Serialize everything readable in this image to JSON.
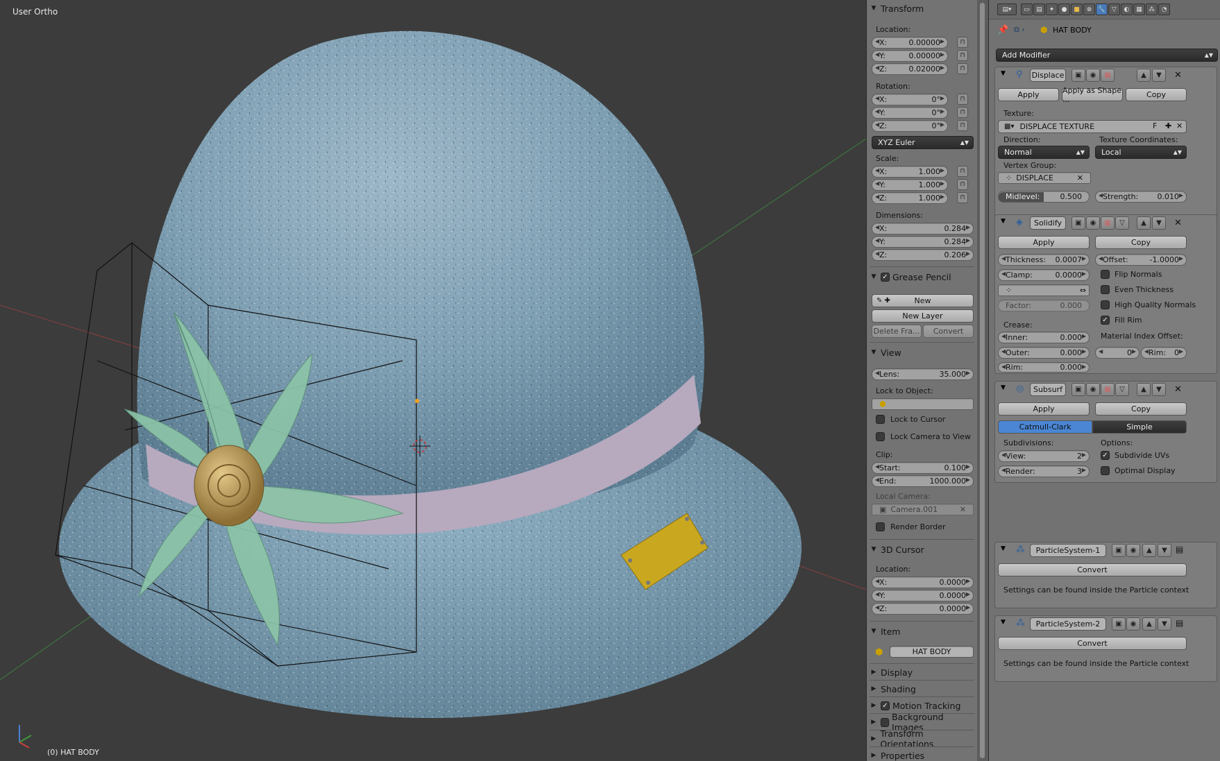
{
  "viewport": {
    "view_label": "User Ortho",
    "object_label": "(0) HAT BODY"
  },
  "npanel": {
    "transform": {
      "header": "Transform",
      "location_label": "Location:",
      "location": [
        {
          "axis": "X:",
          "value": "0.00000"
        },
        {
          "axis": "Y:",
          "value": "0.00000"
        },
        {
          "axis": "Z:",
          "value": "0.02000"
        }
      ],
      "rotation_label": "Rotation:",
      "rotation": [
        {
          "axis": "X:",
          "value": "0°"
        },
        {
          "axis": "Y:",
          "value": "0°"
        },
        {
          "axis": "Z:",
          "value": "0°"
        }
      ],
      "rotation_mode": "XYZ Euler",
      "scale_label": "Scale:",
      "scale": [
        {
          "axis": "X:",
          "value": "1.000"
        },
        {
          "axis": "Y:",
          "value": "1.000"
        },
        {
          "axis": "Z:",
          "value": "1.000"
        }
      ],
      "dimensions_label": "Dimensions:",
      "dimensions": [
        {
          "axis": "X:",
          "value": "0.284"
        },
        {
          "axis": "Y:",
          "value": "0.284"
        },
        {
          "axis": "Z:",
          "value": "0.206"
        }
      ]
    },
    "grease_pencil": {
      "header": "Grease Pencil",
      "new_label": "New",
      "new_layer_label": "New Layer",
      "delete_frame_label": "Delete Fra...",
      "convert_label": "Convert"
    },
    "view": {
      "header": "View",
      "lens_label": "Lens:",
      "lens_value": "35.000",
      "lock_to_object_label": "Lock to Object:",
      "lock_to_cursor_label": "Lock to Cursor",
      "lock_camera_label": "Lock Camera to View",
      "clip_label": "Clip:",
      "clip_start_label": "Start:",
      "clip_start_value": "0.100",
      "clip_end_label": "End:",
      "clip_end_value": "1000.000",
      "local_camera_label": "Local Camera:",
      "local_camera_value": "Camera.001",
      "render_border_label": "Render Border"
    },
    "cursor": {
      "header": "3D Cursor",
      "location_label": "Location:",
      "location": [
        {
          "axis": "X:",
          "value": "0.0000"
        },
        {
          "axis": "Y:",
          "value": "0.0000"
        },
        {
          "axis": "Z:",
          "value": "0.0000"
        }
      ]
    },
    "item": {
      "header": "Item",
      "name": "HAT BODY"
    },
    "collapsed": [
      "Display",
      "Shading",
      "Motion Tracking",
      "Background Images",
      "Transform Orientations",
      "Properties"
    ]
  },
  "props": {
    "object_name": "HAT BODY",
    "add_modifier_label": "Add Modifier",
    "displace": {
      "name": "Displace",
      "apply_label": "Apply",
      "apply_shape_label": "Apply as Shape ...",
      "copy_label": "Copy",
      "texture_label": "Texture:",
      "texture_value": "DISPLACE TEXTURE",
      "texture_f": "F",
      "direction_label": "Direction:",
      "direction_value": "Normal",
      "tex_coords_label": "Texture Coordinates:",
      "tex_coords_value": "Local",
      "vgroup_label": "Vertex Group:",
      "vgroup_value": "DISPLACE",
      "midlevel_label": "Midlevel:",
      "midlevel_value": "0.500",
      "strength_label": "Strength:",
      "strength_value": "0.010"
    },
    "solidify": {
      "name": "Solidify",
      "apply_label": "Apply",
      "copy_label": "Copy",
      "thickness_label": "Thickness:",
      "thickness_value": "0.0007",
      "offset_label": "Offset:",
      "offset_value": "-1.0000",
      "clamp_label": "Clamp:",
      "clamp_value": "0.0000",
      "flip_normals_label": "Flip Normals",
      "even_thickness_label": "Even Thickness",
      "hq_normals_label": "High Quality Normals",
      "fill_rim_label": "Fill Rim",
      "factor_label": "Factor:",
      "factor_value": "0.000",
      "crease_label": "Crease:",
      "inner_label": "Inner:",
      "inner_value": "0.000",
      "outer_label": "Outer:",
      "outer_value": "0.000",
      "rim_label": "Rim:",
      "rim_value": "0.000",
      "mat_index_label": "Material Index Offset:",
      "mat_index_value": "0",
      "mat_rim_label": "Rim:",
      "mat_rim_value": "0"
    },
    "subsurf": {
      "name": "Subsurf",
      "apply_label": "Apply",
      "copy_label": "Copy",
      "catmull_label": "Catmull-Clark",
      "simple_label": "Simple",
      "subdivisions_label": "Subdivisions:",
      "view_label": "View:",
      "view_value": "2",
      "render_label": "Render:",
      "render_value": "3",
      "options_label": "Options:",
      "subdivide_uvs_label": "Subdivide UVs",
      "optimal_display_label": "Optimal Display"
    },
    "particles1": {
      "name": "ParticleSystem-1",
      "convert_label": "Convert",
      "info": "Settings can be found inside the Particle context"
    },
    "particles2": {
      "name": "ParticleSystem-2",
      "convert_label": "Convert",
      "info": "Settings can be found inside the Particle context"
    }
  },
  "colors": {
    "hat": "#7f9fb3",
    "band": "#b7a9be",
    "flower": "#8cc4a8",
    "button": "#b8985a",
    "tag": "#c9a820",
    "active_toggle": "#4a86d4"
  }
}
